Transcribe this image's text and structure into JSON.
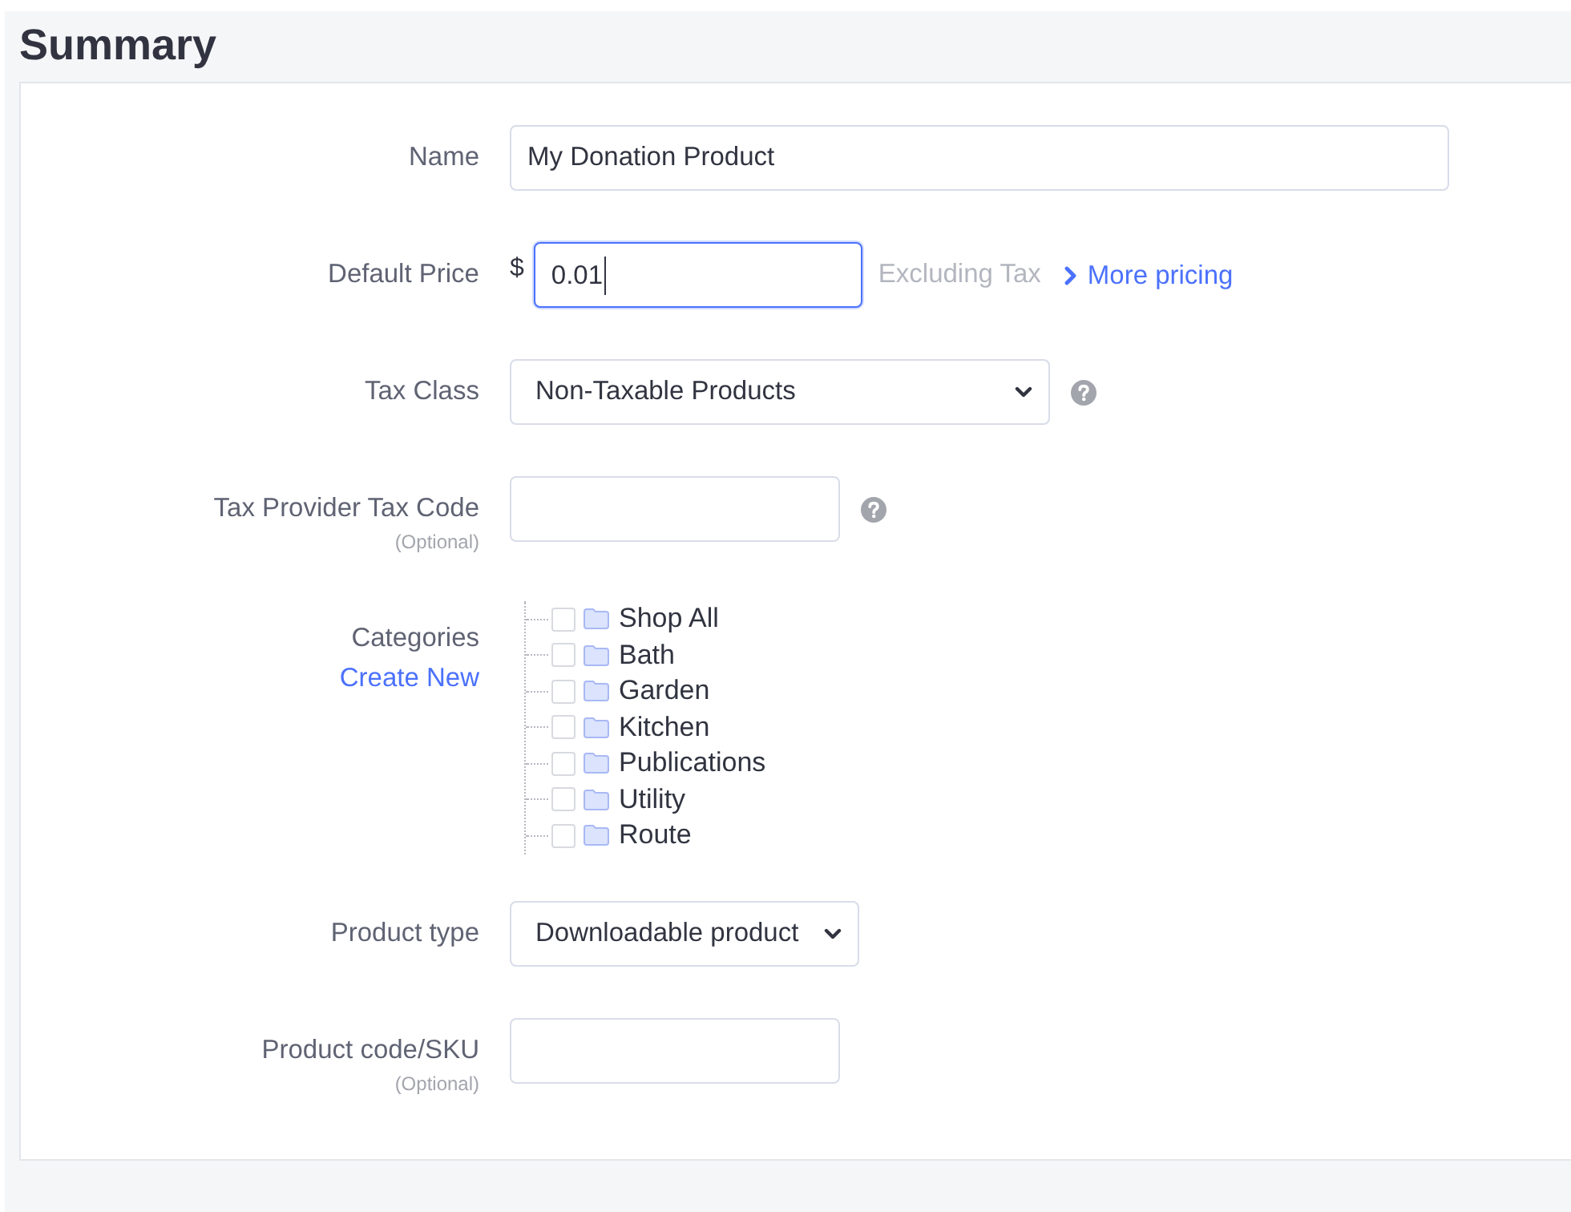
{
  "heading": "Summary",
  "fields": [
    {
      "kind": "text",
      "label": "Name",
      "value": "My Donation Product"
    },
    {
      "kind": "price",
      "label": "Default Price",
      "currency": "$",
      "value": "0.01",
      "focused": true,
      "note": "Excluding Tax",
      "link": "More pricing"
    },
    {
      "kind": "select",
      "label": "Tax Class",
      "value": "Non-Taxable Products",
      "help": true
    },
    {
      "kind": "text",
      "label": "Tax Provider Tax Code",
      "hint": "(Optional)",
      "help": true
    },
    {
      "kind": "tree",
      "label": "Categories",
      "link": "Create New",
      "items": [
        {
          "label": "Shop All",
          "checked": false
        },
        {
          "label": "Bath",
          "checked": false
        },
        {
          "label": "Garden",
          "checked": false
        },
        {
          "label": "Kitchen",
          "checked": false
        },
        {
          "label": "Publications",
          "checked": false
        },
        {
          "label": "Utility",
          "checked": false
        },
        {
          "label": "Route",
          "checked": false
        }
      ]
    },
    {
      "kind": "select",
      "label": "Product type",
      "value": "Downloadable product"
    },
    {
      "kind": "text",
      "label": "Product code/SKU",
      "hint": "(Optional)"
    }
  ]
}
